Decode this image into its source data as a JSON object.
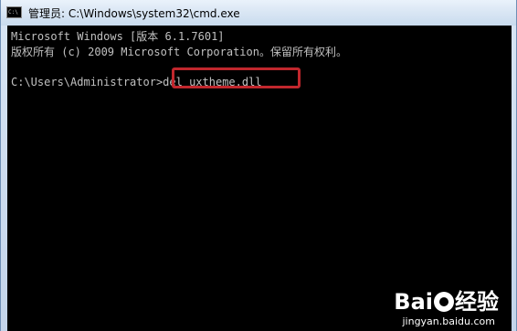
{
  "window": {
    "title": "管理员: C:\\Windows\\system32\\cmd.exe",
    "icon_label": "C:\\"
  },
  "console": {
    "lines": [
      "Microsoft Windows [版本 6.1.7601]",
      "版权所有 (c) 2009 Microsoft Corporation。保留所有权利。"
    ],
    "prompt": "C:\\Users\\Administrator>",
    "command": "del uxtheme.dll"
  },
  "watermark": {
    "brand": "Bai",
    "brand_suffix": "经验",
    "url": "jingyan.baidu.com"
  },
  "colors": {
    "console_bg": "#000000",
    "console_text": "#c0c0c0",
    "highlight": "#c1272d"
  }
}
